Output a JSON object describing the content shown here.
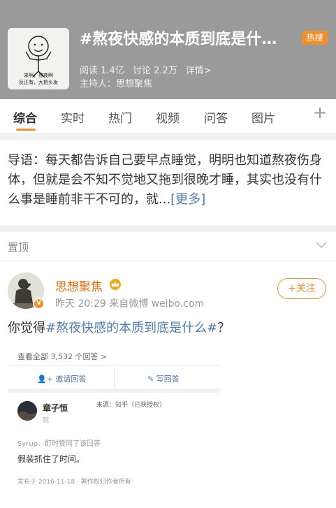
{
  "header": {
    "cover_caption_line1": "来啊，熬夜啊",
    "cover_caption_line2": "反正有，大把头发",
    "title": "#熬夜快感的本质到底是什…",
    "badge": "热搜",
    "reads": "阅读 1.4亿",
    "discussions": "讨论 2.2万",
    "details_link": "详情>",
    "host": "主持人：思想聚焦",
    "background_color": "#9a9a9a"
  },
  "tabs": [
    {
      "label": "综合",
      "active": true
    },
    {
      "label": "实时"
    },
    {
      "label": "热门"
    },
    {
      "label": "视频"
    },
    {
      "label": "问答"
    },
    {
      "label": "图片"
    }
  ],
  "tab_add_icon": "plus-icon",
  "intro": {
    "text": "导语：每天都告诉自己要早点睡觉，明明也知道熬夜伤身体，但就是会不知不觉地又拖到很晚才睡，其实也没有什么事是睡前非干不可的，就...",
    "more": "[更多]"
  },
  "pinned": {
    "label": "置顶",
    "icon": "chevron-down-icon"
  },
  "post": {
    "author": "思想聚焦",
    "crown_icon": "crown-icon",
    "verified_icon": "verified-v-icon",
    "time": "昨天 20:29",
    "source": "来自微博 weibo.com",
    "follow_label": "+关注",
    "text_prefix": "你觉得",
    "hashtag": "#熬夜快感的本质到底是什么#",
    "text_suffix": "？"
  },
  "card": {
    "view_all": "查看全部 3,532 个回答 >",
    "invite": "邀请回答",
    "write": "写回答",
    "answerer": "章子恒",
    "answerer_sub": "玩",
    "source": "来源：知乎（已获授权）",
    "liked_by": "Syrup、酊时赞同了该回答",
    "answer": "假装抓住了时间。",
    "footer": "发布于 2016-11-18 · 著作权归作者所有"
  },
  "colors": {
    "accent": "#f08f2c",
    "link": "#507daf",
    "author": "#e86b0c"
  }
}
